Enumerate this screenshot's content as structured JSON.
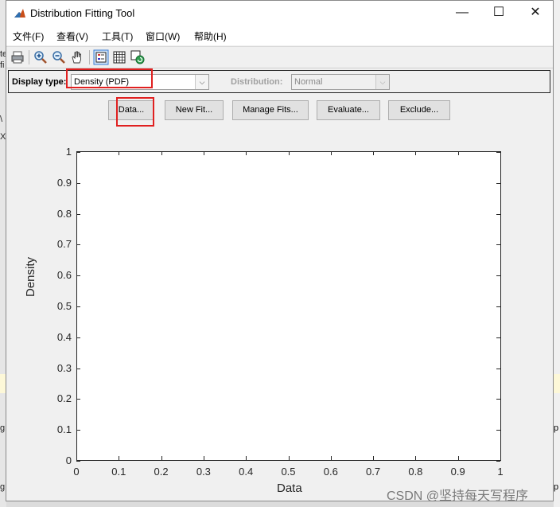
{
  "window": {
    "title": "Distribution Fitting Tool"
  },
  "window_controls": {
    "minimize": "—",
    "maximize": "☐",
    "close": "✕"
  },
  "menu": [
    "文件(F)",
    "查看(V)",
    "工具(T)",
    "窗口(W)",
    "帮助(H)"
  ],
  "toolbar": {
    "icons": [
      "print-icon",
      "zoom-in-icon",
      "zoom-out-icon",
      "pan-hand-icon",
      "legend-toggle-icon",
      "grid-toggle-icon",
      "restore-view-icon"
    ]
  },
  "controls": {
    "display_type_label": "Display type:",
    "display_type_value": "Density (PDF)",
    "distribution_label": "Distribution:",
    "distribution_value": "Normal"
  },
  "buttons": [
    "Data...",
    "New Fit...",
    "Manage Fits...",
    "Evaluate...",
    "Exclude..."
  ],
  "highlight_color": "#e02020",
  "chart_data": {
    "type": "line",
    "title": "",
    "xlabel": "Data",
    "ylabel": "Density",
    "xlim": [
      0,
      1
    ],
    "ylim": [
      0,
      1
    ],
    "x_ticks": [
      "0",
      "0.1",
      "0.2",
      "0.3",
      "0.4",
      "0.5",
      "0.6",
      "0.7",
      "0.8",
      "0.9",
      "1"
    ],
    "y_ticks": [
      "0",
      "0.1",
      "0.2",
      "0.3",
      "0.4",
      "0.5",
      "0.6",
      "0.7",
      "0.8",
      "0.9",
      "1"
    ],
    "series": [],
    "grid": false
  },
  "watermark": "CSDN @坚持每天写程序",
  "background_fragments": [
    "te",
    "fi",
    "\\",
    "X",
    "g",
    "g",
    "p",
    "p"
  ]
}
